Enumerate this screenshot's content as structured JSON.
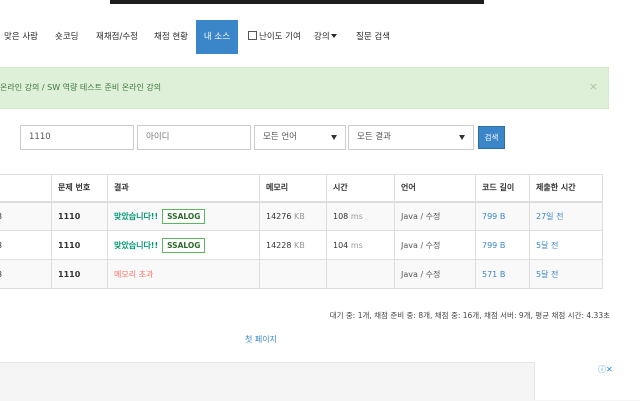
{
  "nav": {
    "items": [
      {
        "label": "맞은 사람"
      },
      {
        "label": "숏코딩"
      },
      {
        "label": "재채점/수정"
      },
      {
        "label": "채점 현황"
      },
      {
        "label": "내 소스"
      },
      {
        "label": "난이도 기여"
      },
      {
        "label": "강의"
      },
      {
        "label": "질문 검색"
      }
    ]
  },
  "alert": {
    "text": "온라인 강의 / SW 역량 테스트 준비 온라인 강의",
    "close": "×"
  },
  "filters": {
    "problem_id": "1110",
    "user_placeholder": "아이디",
    "language": "모든 언어",
    "result": "모든 결과",
    "search_label": "검색"
  },
  "table": {
    "headers": [
      "문제 번호",
      "결과",
      "메모리",
      "시간",
      "언어",
      "코드 길이",
      "제출한 시간"
    ],
    "rows": [
      {
        "id_tail": "3",
        "problem": "1110",
        "result": "맞았습니다!!",
        "share": "SSALOG",
        "memory": "14276",
        "memory_unit": "KB",
        "time": "108",
        "time_unit": "ms",
        "language": "Java / 수정",
        "length": "799 B",
        "submitted": "27일 전"
      },
      {
        "id_tail": "3",
        "problem": "1110",
        "result": "맞았습니다!!",
        "share": "SSALOG",
        "memory": "14228",
        "memory_unit": "KB",
        "time": "104",
        "time_unit": "ms",
        "language": "Java / 수정",
        "length": "799 B",
        "submitted": "5달 전"
      },
      {
        "id_tail": "3",
        "problem": "1110",
        "result": "메모리 초과",
        "share": "",
        "memory": "",
        "memory_unit": "",
        "time": "",
        "time_unit": "",
        "language": "Java / 수정",
        "length": "571 B",
        "submitted": "5달 전"
      }
    ]
  },
  "stats": "대기 중: 1개, 채점 준비 중: 8개, 채점 중: 16개, 채점 서버: 9개, 평균 채점 시간: 4.33초",
  "pagination": {
    "first": "첫 페이지"
  },
  "ad": {
    "choices": "ⓘ✕"
  },
  "colors": {
    "accent": "#3a86c9",
    "success": "#009874",
    "error": "#fa7268",
    "alert_bg": "#dff0d8"
  }
}
